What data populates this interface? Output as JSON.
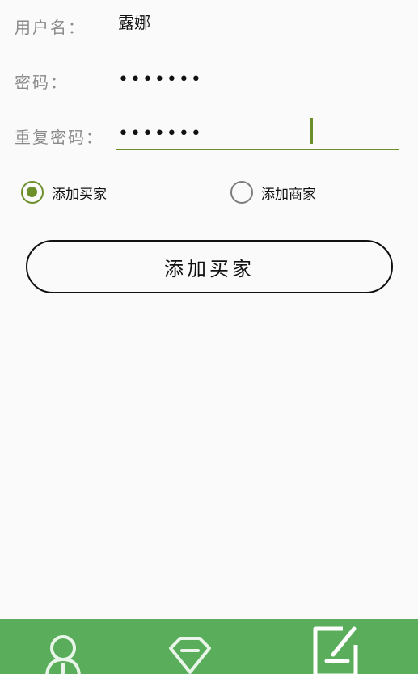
{
  "form": {
    "username": {
      "label": "用户名：",
      "value": "露娜"
    },
    "password": {
      "label": "密码：",
      "value": "•••••••"
    },
    "confirm_password": {
      "label": "重复密码：",
      "value": "•••••••"
    }
  },
  "role_options": [
    {
      "label": "添加买家",
      "selected": true
    },
    {
      "label": "添加商家",
      "selected": false
    }
  ],
  "submit_label": "添加买家",
  "bottom_nav": {
    "background": "#5aad5a",
    "items": [
      {
        "icon": "user-icon"
      },
      {
        "icon": "diamond-icon"
      },
      {
        "icon": "edit-icon",
        "active": true
      }
    ]
  },
  "colors": {
    "accent": "#6a8f2b",
    "nav_bg": "#5aad5a"
  }
}
